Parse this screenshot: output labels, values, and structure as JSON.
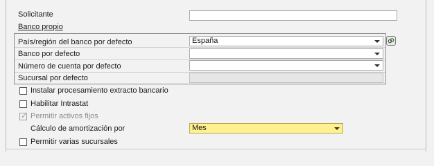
{
  "fields": {
    "solicitante": {
      "label": "Solicitante",
      "value": ""
    },
    "banco_propio": {
      "label": "Banco propio"
    },
    "pais_region": {
      "label": "País/región del banco por defecto",
      "value": "España"
    },
    "banco_defecto": {
      "label": "Banco por defecto",
      "value": ""
    },
    "numero_cuenta": {
      "label": "Número de cuenta por defecto",
      "value": ""
    },
    "sucursal": {
      "label": "Sucursal por defecto",
      "value": ""
    }
  },
  "checkboxes": {
    "extracto": {
      "label": "Instalar procesamiento extracto bancario",
      "checked": false
    },
    "intrastat": {
      "label": "Habilitar Intrastat",
      "checked": false
    },
    "activos_fijos": {
      "label": "Permitir activos fijos",
      "checked": true,
      "disabled": true
    },
    "varias_sucursales": {
      "label": "Permitir varias sucursales",
      "checked": false
    }
  },
  "amortizacion": {
    "label": "Cálculo de amortización por",
    "value": "Mes"
  },
  "icons": {
    "link": "link-icon",
    "dropdown": "chevron-down-icon",
    "tick": "✓"
  }
}
